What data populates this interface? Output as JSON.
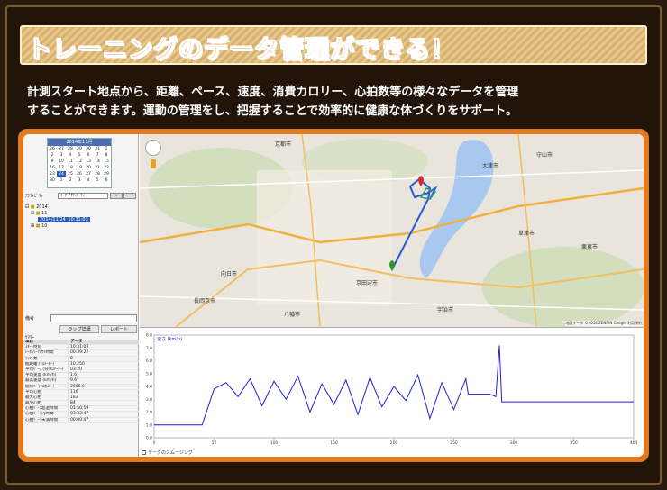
{
  "banner": {
    "title": "トレーニングのデータ管理ができる！"
  },
  "description": {
    "line1": "計測スタート地点から、距離、ペース、速度、消費カロリー、心拍数等の様々なデータを管理",
    "line2": "することができます。運動の管理をし、把握することで効率的に健康な体づくりをサポート。"
  },
  "app": {
    "calendar": {
      "header": "2014年11月",
      "days": [
        "26",
        "27",
        "28",
        "29",
        "30",
        "31",
        "1",
        "2",
        "3",
        "4",
        "5",
        "6",
        "7",
        "8",
        "9",
        "10",
        "11",
        "12",
        "13",
        "14",
        "15",
        "16",
        "17",
        "18",
        "19",
        "20",
        "21",
        "22",
        "23",
        "24",
        "25",
        "26",
        "27",
        "28",
        "29",
        "30",
        "1",
        "2",
        "3",
        "4",
        "5",
        "6"
      ],
      "selected_index": 29
    },
    "activity": {
      "label": "ｱｸﾃｨﾋﾞﾃｨ",
      "select_value": "ｲｰﾌﾞｱｸﾃｨﾋﾞﾃｨ",
      "btn1": "+",
      "btn2": "ｰ"
    },
    "tree": {
      "year": "2014",
      "month": "11",
      "entry": "2014/11/24_10:31:03",
      "month2": "10"
    },
    "memo_label": "備考",
    "tabs": {
      "lap": "ラップ詳細",
      "report": "レポート"
    },
    "summary_label": "ｻﾏﾘｰ",
    "table": {
      "headers": [
        "項目",
        "データ"
      ],
      "rows": [
        [
          "ｽﾀｰﾄ時刻",
          "10:31:03"
        ],
        [
          "ﾄｰﾀﾙﾜｰｸｱｳﾄ時間",
          "00:39:22"
        ],
        [
          "ﾗｯﾌﾟ数",
          "0"
        ],
        [
          "総距離 (ｷﾛﾒｰﾀｰ)",
          "10.250"
        ],
        [
          "平均ﾍﾟｰｽ (分/ｷﾛﾒｰﾀｰ)",
          "03:20"
        ],
        [
          "平均速度 (km/h)",
          "1.6"
        ],
        [
          "最高速度 (km/h)",
          "9.6"
        ],
        [
          "総ｶﾛﾘｰ (ｷﾛｶﾛﾘｰ)",
          "2666.6"
        ],
        [
          "平均心拍",
          "116"
        ],
        [
          "最大心拍",
          "183"
        ],
        [
          "最小心拍",
          "84"
        ],
        [
          "心拍ｿﾞｰﾝ超過時間",
          "01:50:59"
        ],
        [
          "心拍ｿﾞｰﾝ内時間",
          "03:33:47"
        ],
        [
          "心拍ｿﾞｰﾝ未満時間",
          "00:00:47"
        ]
      ]
    },
    "map": {
      "labels": [
        "京都市",
        "大津市",
        "守山市",
        "宇治市",
        "八幡市",
        "長岡京市",
        "向日市",
        "草津市",
        "栗東市",
        "京田辺市"
      ],
      "attribution": "地図データ ©2014 ZENRIN Google 利用規約"
    },
    "chart": {
      "smoothing_label": "データのスムージング"
    }
  },
  "chart_data": {
    "type": "line",
    "series": [
      {
        "name": "速さ (km/h)",
        "x_points": [
          0,
          40,
          50,
          60,
          70,
          80,
          90,
          100,
          110,
          120,
          130,
          140,
          150,
          160,
          170,
          180,
          190,
          200,
          210,
          220,
          230,
          240,
          250,
          260,
          262,
          270,
          280,
          285,
          288,
          290,
          300,
          320,
          340,
          360,
          380,
          400
        ],
        "values": [
          1.0,
          1.0,
          3.8,
          4.3,
          3.2,
          4.6,
          2.5,
          4.4,
          3.0,
          4.8,
          2.0,
          4.2,
          2.6,
          4.5,
          1.8,
          4.7,
          2.4,
          4.0,
          2.9,
          4.9,
          1.5,
          4.3,
          2.2,
          4.6,
          3.4,
          3.4,
          3.4,
          3.2,
          7.2,
          2.8,
          2.8,
          2.8,
          2.8,
          2.8,
          2.8,
          2.8
        ]
      }
    ],
    "xlim": [
      0,
      400
    ],
    "ylim": [
      0,
      8
    ],
    "x_ticks": [
      0,
      50,
      100,
      150,
      200,
      250,
      300,
      350,
      400
    ],
    "y_ticks": [
      0,
      1,
      2,
      3,
      4,
      5,
      6,
      7,
      8
    ],
    "x_tick_labels": [
      "0",
      "50",
      "100",
      "150",
      "200",
      "250",
      "300",
      "350",
      "400"
    ],
    "y_tick_labels": [
      "0.0",
      "1.0",
      "2.0",
      "3.0",
      "4.0",
      "5.0",
      "6.0",
      "7.0",
      "8.0"
    ],
    "grid": false,
    "colors": {
      "line": "#1f1fd0"
    }
  }
}
